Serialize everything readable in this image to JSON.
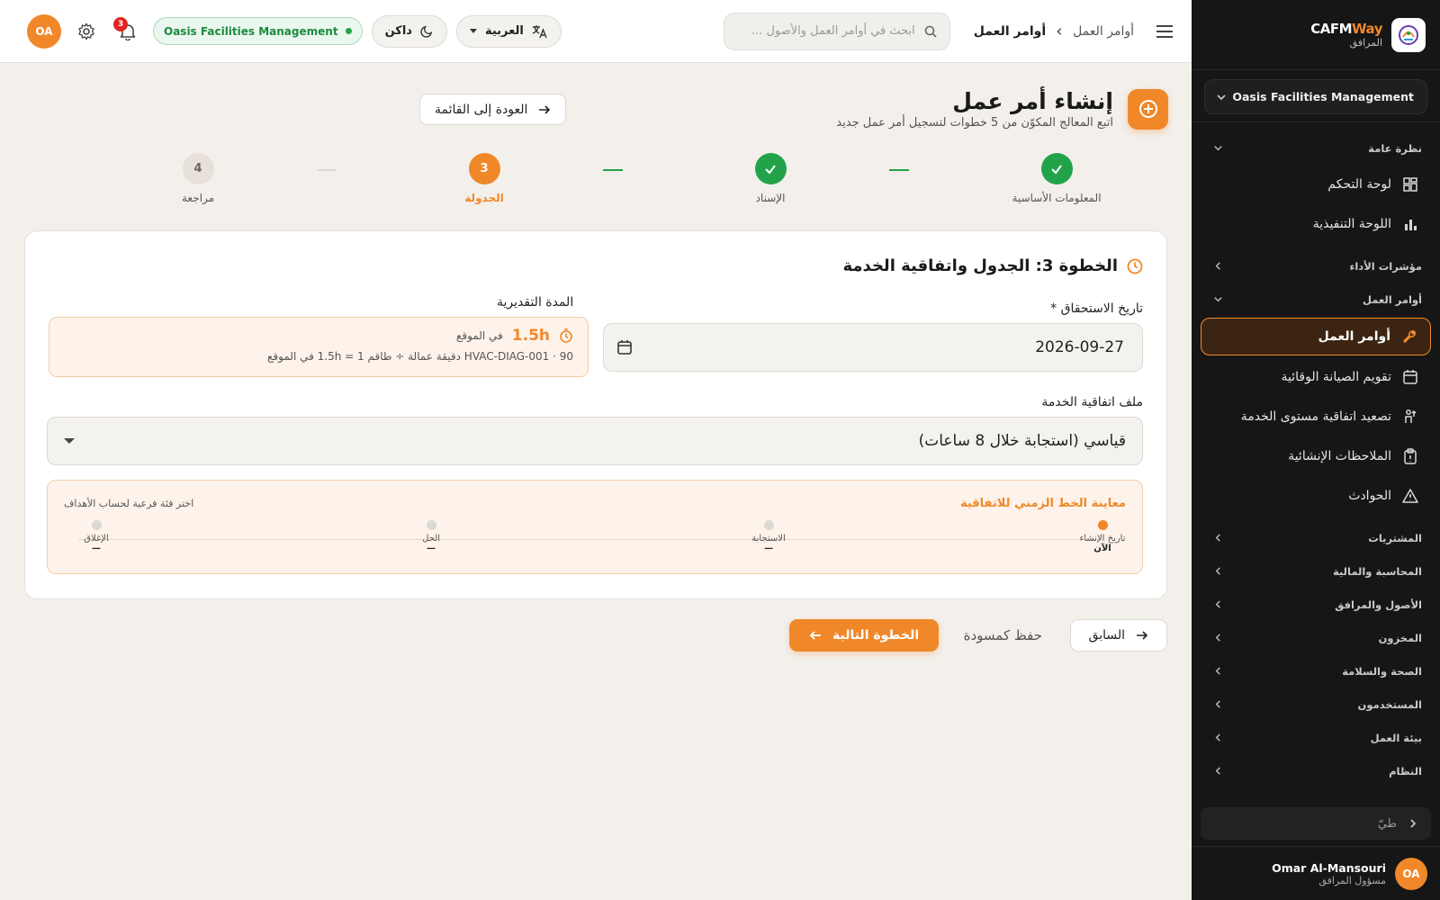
{
  "brand": {
    "name_main": "CAFM",
    "name_accent": "Way",
    "sub": "المرافق"
  },
  "sidebar": {
    "org": "Oasis Facilities Management",
    "groups": {
      "overview": "نظرة عامة",
      "kpis": "مؤشرات الأداء",
      "work_orders": "أوامر العمل",
      "procurement": "المشتريات",
      "accounting": "المحاسبة والمالية",
      "assets": "الأصول والمرافق",
      "inventory": "المخزون",
      "hse": "الصحة والسلامة",
      "users": "المستخدمون",
      "environment": "بيئة العمل",
      "system": "النظام"
    },
    "items": {
      "dashboard": "لوحة التحكم",
      "executive": "اللوحة التنفيذية",
      "work_orders": "أوامر العمل",
      "pm_calendar": "تقويم الصيانة الوقائية",
      "sla_escalation": "تصعيد اتفاقية مستوى الخدمة",
      "snags": "الملاحظات الإنشائية",
      "incidents": "الحوادث"
    },
    "collapse_label": "طيّ",
    "user": {
      "initials": "OA",
      "name": "Omar Al-Mansouri",
      "role": "مسؤول المرافق"
    }
  },
  "header": {
    "breadcrumb": {
      "parent": "أوامر العمل",
      "current": "أوامر العمل"
    },
    "search_placeholder": "ابحث في أوامر العمل والأصول ...",
    "language": "العربية",
    "theme": "داكن",
    "org": "Oasis Facilities Management",
    "notifications": "3",
    "user_initials": "OA"
  },
  "page": {
    "title": "إنشاء أمر عمل",
    "subtitle": "اتبع المعالج المكوّن من 5 خطوات لتسجيل أمر عمل جديد",
    "back": "العودة إلى القائمة"
  },
  "steps": [
    {
      "label": "المعلومات الأساسية",
      "state": "done",
      "num": ""
    },
    {
      "label": "الإسناد",
      "state": "done",
      "num": ""
    },
    {
      "label": "الجدولة",
      "state": "current",
      "num": "3"
    },
    {
      "label": "مراجعة",
      "state": "todo",
      "num": "4"
    }
  ],
  "form": {
    "title": "الخطوة 3: الجدول واتفاقية الخدمة",
    "due_label": "تاريخ الاستحقاق *",
    "due_value": "2026-09-27",
    "duration_label": "المدة التقديرية",
    "duration_value": "1.5h",
    "duration_where": "في الموقع",
    "duration_formula": "HVAC-DIAG-001 · 90 دقيقة عمالة ÷ طاقم 1 = 1.5h في الموقع",
    "sla_label": "ملف اتفاقية الخدمة",
    "sla_value": "قياسي (استجابة خلال 8 ساعات)",
    "timeline_title": "معاينة الخط الزمني للاتفاقية",
    "timeline_hint": "اختر فئة فرعية لحساب الأهداف",
    "timeline": [
      {
        "name": "تاريخ الإنشاء",
        "value": "الآن",
        "active": true
      },
      {
        "name": "الاستجابة",
        "value": "—",
        "active": false
      },
      {
        "name": "الحل",
        "value": "—",
        "active": false
      },
      {
        "name": "الإغلاق",
        "value": "—",
        "active": false
      }
    ]
  },
  "actions": {
    "prev": "السابق",
    "draft": "حفظ كمسودة",
    "next": "الخطوة التالية"
  },
  "colors": {
    "accent": "#f0882a",
    "success": "#22a34a",
    "sidebar_bg": "#161616"
  }
}
